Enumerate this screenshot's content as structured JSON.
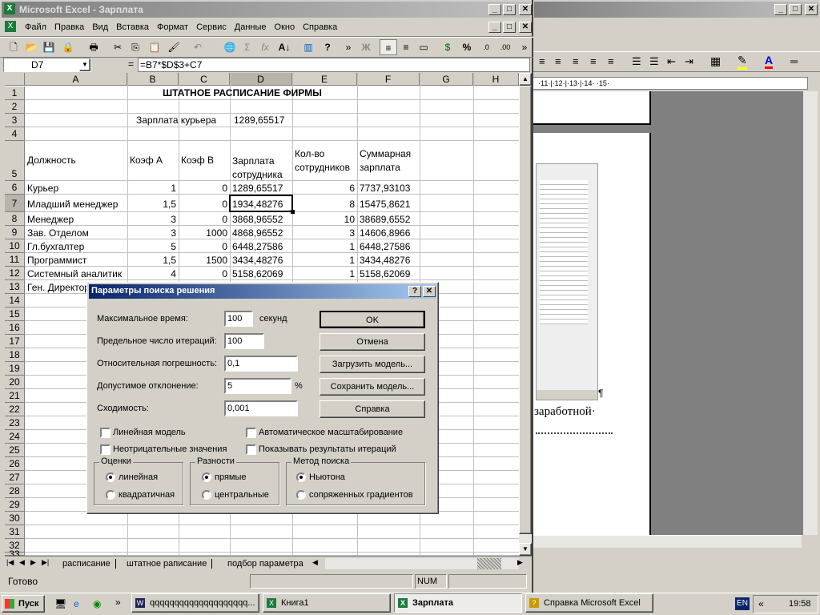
{
  "excel": {
    "title": "Microsoft Excel - Зарплата",
    "menu": [
      "Файл",
      "Правка",
      "Вид",
      "Вставка",
      "Формат",
      "Сервис",
      "Данные",
      "Окно",
      "Справка"
    ],
    "name_box": "D7",
    "formula_eq": "=",
    "formula": "=B7*$D$3+C7",
    "columns": [
      "A",
      "B",
      "C",
      "D",
      "E",
      "F",
      "G",
      "H"
    ],
    "rows": [
      "1",
      "2",
      "3",
      "4",
      "5",
      "6",
      "7",
      "8",
      "9",
      "10",
      "11",
      "12",
      "13",
      "14",
      "15",
      "16",
      "17",
      "18",
      "19",
      "20",
      "21",
      "22",
      "23",
      "24",
      "25",
      "26",
      "27",
      "28",
      "29",
      "30",
      "31",
      "32",
      "33"
    ],
    "title_cell": "ШТАТНОЕ РАСПИСАНИЕ ФИРМЫ",
    "courier_label": "Зарплата курьера",
    "courier_value": "1289,65517",
    "headers": {
      "a": "Должность",
      "b": "Коэф А",
      "c": "Коэф В",
      "d1": "Зарплата",
      "d2": "сотрудника",
      "e1": "Кол-во",
      "e2": "сотрудников",
      "f1": "Суммарная",
      "f2": "зарплата"
    },
    "data": [
      [
        "Курьер",
        "1",
        "0",
        "1289,65517",
        "6",
        "7737,93103"
      ],
      [
        "Младший менеджер",
        "1,5",
        "0",
        "1934,48276",
        "8",
        "15475,8621"
      ],
      [
        "Менеджер",
        "3",
        "0",
        "3868,96552",
        "10",
        "38689,6552"
      ],
      [
        "Зав. Отделом",
        "3",
        "1000",
        "4868,96552",
        "3",
        "14606,8966"
      ],
      [
        "Гл.бухгалтер",
        "5",
        "0",
        "6448,27586",
        "1",
        "6448,27586"
      ],
      [
        "Программист",
        "1,5",
        "1500",
        "3434,48276",
        "1",
        "3434,48276"
      ],
      [
        "Системный аналитик",
        "4",
        "0",
        "5158,62069",
        "1",
        "5158,62069"
      ],
      [
        "Ген. Директор",
        "",
        "",
        "",
        "",
        ""
      ]
    ],
    "sheets": [
      "расписание",
      "штатное раписание",
      "подбор параметра"
    ],
    "status": "Готово",
    "num": "NUM"
  },
  "dialog": {
    "title": "Параметры поиска решения",
    "fields": [
      {
        "label": "Максимальное время:",
        "value": "100",
        "suffix": "секунд"
      },
      {
        "label": "Предельное число итераций:",
        "value": "100",
        "suffix": ""
      },
      {
        "label": "Относительная погрешность:",
        "value": "0,1",
        "suffix": ""
      },
      {
        "label": "Допустимое отклонение:",
        "value": "5",
        "suffix": "%"
      },
      {
        "label": "Сходимость:",
        "value": "0,001",
        "suffix": ""
      }
    ],
    "buttons": [
      "OK",
      "Отмена",
      "Загрузить модель...",
      "Сохранить модель...",
      "Справка"
    ],
    "checks": [
      "Линейная модель",
      "Автоматическое масштабирование",
      "Неотрицательные значения",
      "Показывать результаты итераций"
    ],
    "groups": [
      {
        "title": "Оценки",
        "options": [
          "линейная",
          "квадратичная"
        ]
      },
      {
        "title": "Разности",
        "options": [
          "прямые",
          "центральные"
        ]
      },
      {
        "title": "Метод поиска",
        "options": [
          "Ньютона",
          "сопряженных градиентов"
        ]
      }
    ]
  },
  "word": {
    "ruler": "·11·|·12·|·13·|·14· ·15·",
    "text": "заработной·",
    "pilcrow": "¶"
  },
  "taskbar": {
    "start": "Пуск",
    "tasks": [
      "qqqqqqqqqqqqqqqqqqqq...",
      "Книга1",
      "Зарплата",
      "Справка Microsoft Excel"
    ],
    "lang": "EN",
    "time": "19:58",
    "arrows": "»"
  },
  "colors": {
    "title_active": "#0a246a",
    "title_inactive": "#808080",
    "face": "#d4d0c8"
  }
}
